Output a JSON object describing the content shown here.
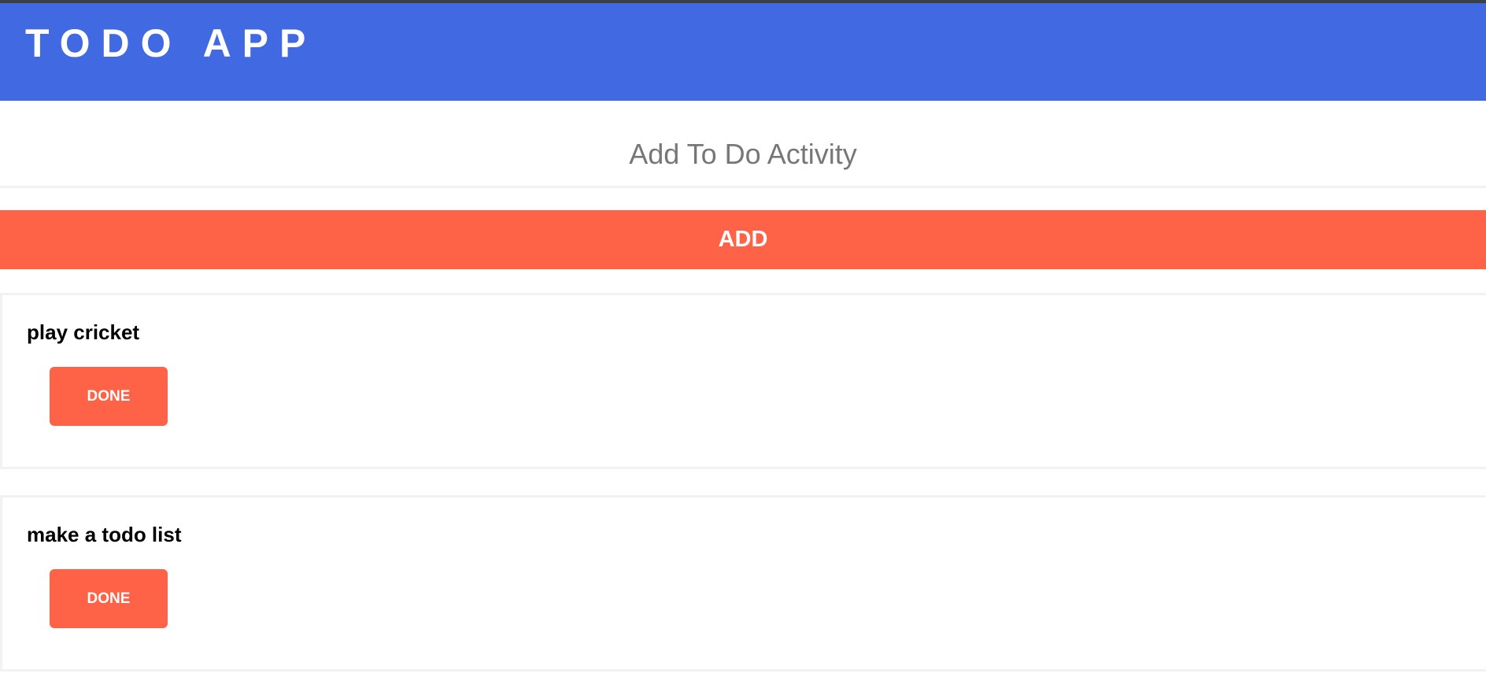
{
  "header": {
    "title": "TODO APP"
  },
  "form": {
    "placeholder": "Add To Do Activity",
    "add_label": "ADD"
  },
  "todos": [
    {
      "text": "play cricket",
      "done_label": "DONE"
    },
    {
      "text": "make a todo list",
      "done_label": "DONE"
    }
  ],
  "colors": {
    "header": "#4169e1",
    "accent": "#ff6347"
  }
}
